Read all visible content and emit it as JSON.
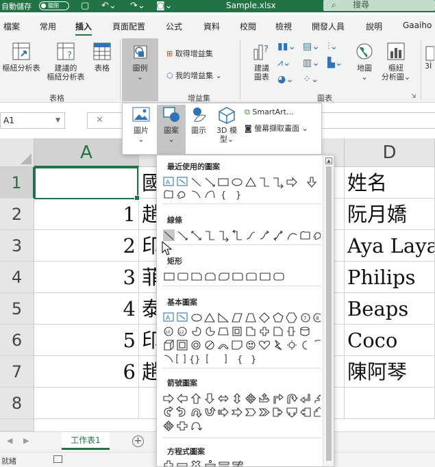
{
  "titlebar": {
    "autosave": "自動儲存",
    "autosave_state": "關閉",
    "filename": "Sample.xlsx",
    "search_placeholder": "搜尋"
  },
  "tabs": [
    "檔案",
    "常用",
    "插入",
    "頁面配置",
    "公式",
    "資料",
    "校閱",
    "檢視",
    "開發人員",
    "說明",
    "Gaaiho P"
  ],
  "active_tab": "插入",
  "ribbon": {
    "pivot_table": "樞紐分析表",
    "recommended_pivot_line1": "建議的",
    "recommended_pivot_line2": "樞紐分析表",
    "table": "表格",
    "tables_group": "表格",
    "illustrations": "圖例",
    "get_addins": "取得增益集",
    "my_addins": "我的增益集",
    "addins_group": "增益集",
    "recommended_charts_line1": "建議",
    "recommended_charts_line2": "圖表",
    "map": "地圖",
    "pivot_chart_line1": "樞紐",
    "pivot_chart_line2": "分析圖",
    "charts_group": "圖表",
    "partial_right": "3İ"
  },
  "illustrations_menu": {
    "picture": "圖片",
    "shapes": "圖案",
    "icons": "圖示",
    "model_3d_line1": "3D 模",
    "model_3d_line2": "型",
    "smartart": "SmartArt...",
    "screenshot": "螢幕擷取畫面"
  },
  "formula_bar": {
    "name_box": "A1"
  },
  "grid": {
    "columns": [
      "A",
      "D"
    ],
    "rows": [
      "1",
      "2",
      "3",
      "4",
      "5",
      "6",
      "7",
      "8"
    ],
    "col_a": [
      "",
      "1",
      "2",
      "3",
      "4",
      "5",
      "6",
      ""
    ],
    "col_b_partial": [
      "國",
      "趙",
      "印",
      "菲",
      "泰",
      "印",
      "趙",
      ""
    ],
    "col_d": [
      "姓名",
      "阮月嬌",
      "Aya Laya",
      "Philips",
      "Beaps",
      "Coco",
      "陳阿琴",
      ""
    ]
  },
  "shapes_menu": {
    "recent": "最近使用的圖案",
    "lines": "線條",
    "rectangles": "矩形",
    "basic": "基本圖案",
    "arrows": "箭號圖案",
    "equation": "方程式圖案"
  },
  "sheet_tab": "工作表1",
  "status": "就緒"
}
